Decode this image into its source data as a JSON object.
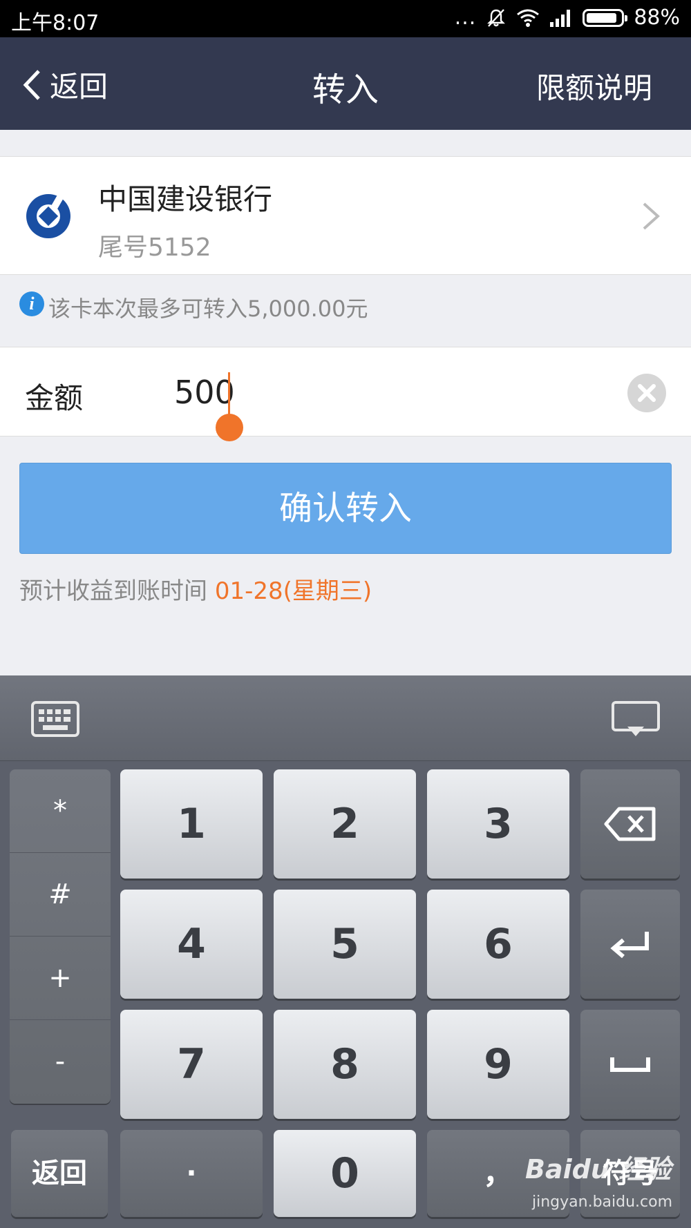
{
  "status_bar": {
    "time": "上午8:07",
    "dots": "...",
    "battery": "88%",
    "battery_level": 0.88
  },
  "nav": {
    "back": "返回",
    "title": "转入",
    "right": "限额说明"
  },
  "bank": {
    "name": "中国建设银行",
    "tail": "尾号5152"
  },
  "info": {
    "icon": "i",
    "text": "该卡本次最多可转入5,000.00元"
  },
  "amount": {
    "label": "金额",
    "value": "500"
  },
  "confirm": {
    "label": "确认转入"
  },
  "eta": {
    "prefix": "预计收益到账时间 ",
    "date": "01-28(星期三)"
  },
  "keyboard": {
    "symbols": [
      "*",
      "#",
      "+",
      "-"
    ],
    "digits": [
      "1",
      "2",
      "3",
      "4",
      "5",
      "6",
      "7",
      "8",
      "9",
      "0"
    ],
    "back": "返回",
    "dot": "·",
    "comma": "，",
    "symbols_key": "符号"
  },
  "watermark": {
    "brand": "Baidu 经验",
    "url": "jingyan.baidu.com"
  },
  "colors": {
    "nav_bg": "#333950",
    "accent": "#f0742a",
    "button": "#66a9ea",
    "bank_blue": "#1a4fa3"
  }
}
